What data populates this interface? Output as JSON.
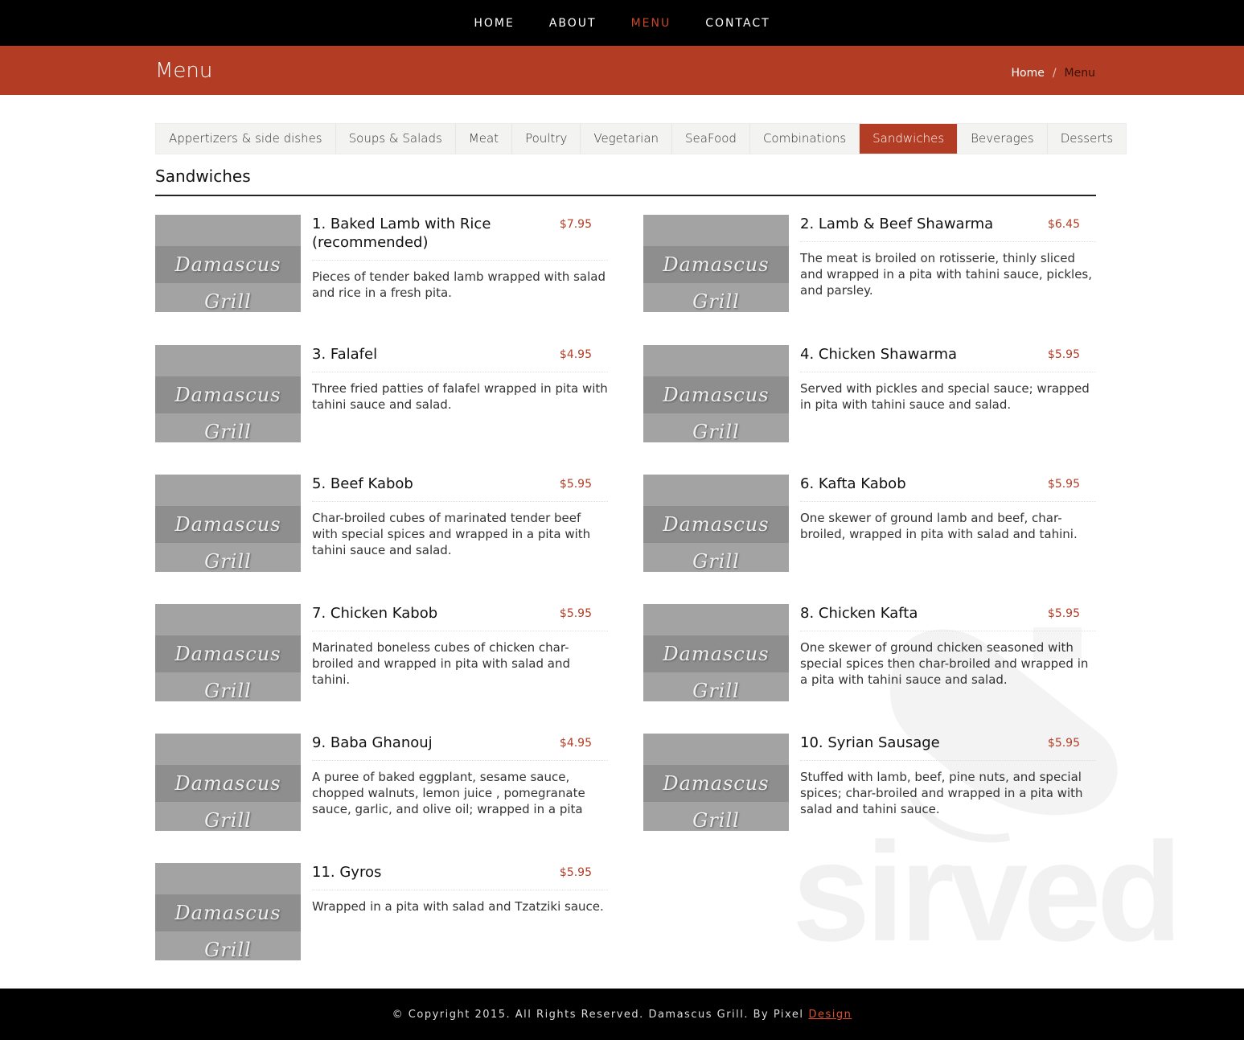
{
  "nav": {
    "items": [
      {
        "label": "HOME",
        "active": false
      },
      {
        "label": "ABOUT",
        "active": false
      },
      {
        "label": "MENU",
        "active": true
      },
      {
        "label": "CONTACT",
        "active": false
      }
    ]
  },
  "banner": {
    "title": "Menu",
    "breadcrumb": {
      "home": "Home",
      "separator": "/",
      "current": "Menu"
    }
  },
  "tabs": [
    {
      "label": "Appertizers & side dishes",
      "active": false
    },
    {
      "label": "Soups & Salads",
      "active": false
    },
    {
      "label": "Meat",
      "active": false
    },
    {
      "label": "Poultry",
      "active": false
    },
    {
      "label": "Vegetarian",
      "active": false
    },
    {
      "label": "SeaFood",
      "active": false
    },
    {
      "label": "Combinations",
      "active": false
    },
    {
      "label": "Sandwiches",
      "active": true
    },
    {
      "label": "Beverages",
      "active": false
    },
    {
      "label": "Desserts",
      "active": false
    }
  ],
  "section": {
    "title": "Sandwiches"
  },
  "thumb_logo": "Damascus Grill",
  "items": [
    {
      "name": "1. Baked Lamb with Rice (recommended)",
      "price": "$7.95",
      "desc": "Pieces of tender baked lamb wrapped with salad and rice in a fresh pita."
    },
    {
      "name": "2. Lamb & Beef Shawarma",
      "price": "$6.45",
      "desc": "The meat is broiled on rotisserie, thinly sliced and wrapped in a pita with tahini sauce, pickles, and parsley."
    },
    {
      "name": "3. Falafel",
      "price": "$4.95",
      "desc": "Three fried patties of falafel wrapped in pita with tahini sauce and salad."
    },
    {
      "name": "4. Chicken Shawarma",
      "price": "$5.95",
      "desc": "Served with pickles and special sauce; wrapped in pita with tahini sauce and salad."
    },
    {
      "name": "5. Beef Kabob",
      "price": "$5.95",
      "desc": "Char-broiled cubes of marinated tender beef with special spices and wrapped in a pita with tahini sauce and salad."
    },
    {
      "name": "6. Kafta Kabob",
      "price": "$5.95",
      "desc": "One skewer of ground lamb and beef, char-broiled, wrapped in pita with salad and tahini."
    },
    {
      "name": "7. Chicken Kabob",
      "price": "$5.95",
      "desc": "Marinated boneless cubes of chicken char-broiled and wrapped in pita with salad and tahini."
    },
    {
      "name": "8. Chicken Kafta",
      "price": "$5.95",
      "desc": "One skewer of ground chicken seasoned with special spices then char-broiled and wrapped in a pita with tahini sauce and salad."
    },
    {
      "name": "9. Baba Ghanouj",
      "price": "$4.95",
      "desc": "A puree of baked eggplant, sesame sauce, chopped walnuts, lemon juice , pomegranate sauce, garlic, and olive oil; wrapped in a pita"
    },
    {
      "name": "10. Syrian Sausage",
      "price": "$5.95",
      "desc": "Stuffed with lamb, beef, pine nuts, and special spices; char-broiled and wrapped in a pita with salad and tahini sauce."
    },
    {
      "name": "11. Gyros",
      "price": "$5.95",
      "desc": "Wrapped in a pita with salad and Tzatziki sauce."
    }
  ],
  "watermark": "sirved",
  "footer": {
    "copyright": "© Copyright 2015. All Rights Reserved. Damascus Grill. By Pixel",
    "brand": "Design"
  },
  "colors": {
    "accent": "#b33d24",
    "nav_active": "#c9452b",
    "price": "#b33d24"
  }
}
